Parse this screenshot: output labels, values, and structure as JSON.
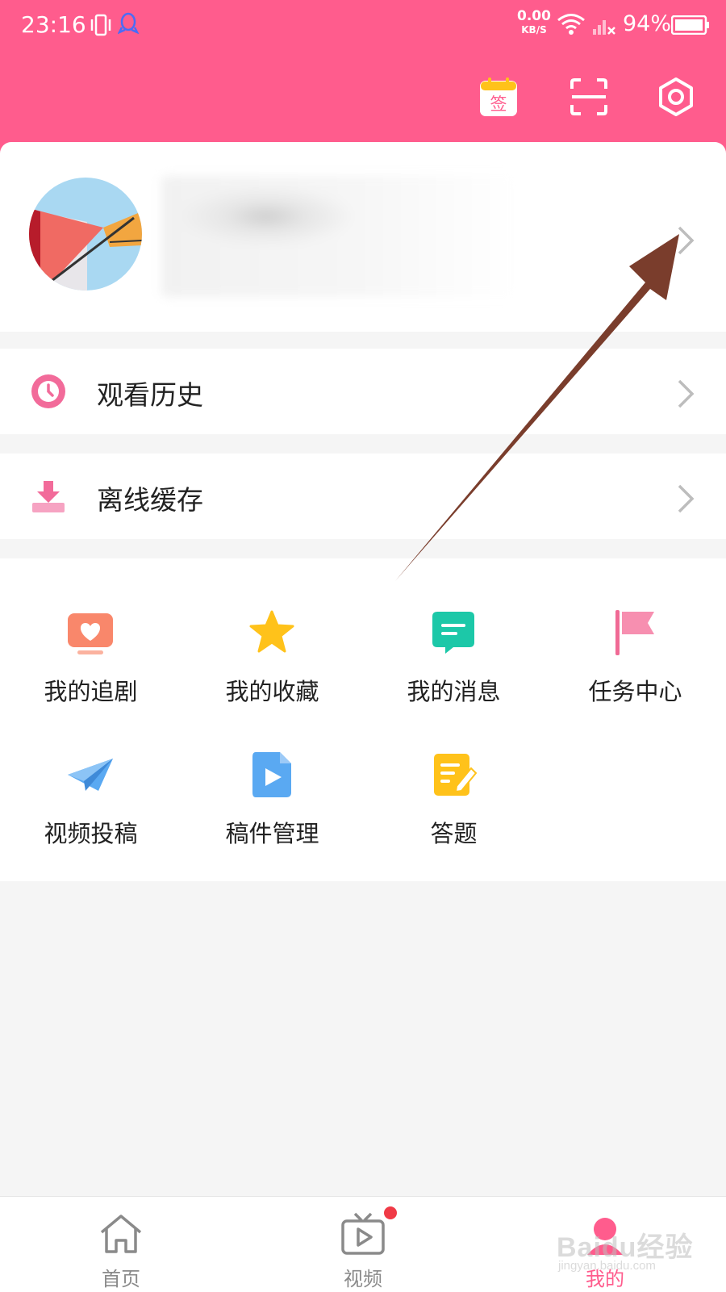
{
  "status_bar": {
    "time": "23:16",
    "net_speed_value": "0.00",
    "net_speed_unit": "KB/S",
    "battery": "94%",
    "icons": [
      "vibrate-icon",
      "qq-icon",
      "wifi-icon",
      "signal-icon",
      "battery-icon"
    ]
  },
  "header": {
    "sign_in_label": "签",
    "actions": [
      "calendar-sign-in-icon",
      "scan-icon",
      "settings-icon"
    ]
  },
  "menu": [
    {
      "label": "观看历史",
      "icon": "clock-icon"
    },
    {
      "label": "离线缓存",
      "icon": "download-icon"
    }
  ],
  "grid": [
    {
      "label": "我的追剧",
      "icon": "tv-heart-icon"
    },
    {
      "label": "我的收藏",
      "icon": "star-icon"
    },
    {
      "label": "我的消息",
      "icon": "message-icon"
    },
    {
      "label": "任务中心",
      "icon": "flag-icon"
    },
    {
      "label": "视频投稿",
      "icon": "paper-plane-icon"
    },
    {
      "label": "稿件管理",
      "icon": "video-file-icon"
    },
    {
      "label": "答题",
      "icon": "edit-note-icon"
    }
  ],
  "tabs": [
    {
      "label": "首页",
      "icon": "home-icon",
      "active": false
    },
    {
      "label": "视频",
      "icon": "tv-play-icon",
      "active": false,
      "badge": true
    },
    {
      "label": "我的",
      "icon": "profile-icon",
      "active": true
    }
  ],
  "colors": {
    "brand_pink": "#ff5c8d",
    "star_yellow": "#ffc21a",
    "message_teal": "#1cc8a8",
    "flag_pink": "#f06a95",
    "plane_blue": "#5aa9f2",
    "file_blue": "#5aa9f2",
    "note_yellow": "#ffc21a",
    "annotation_arrow": "#7a3d2c"
  },
  "watermark": {
    "main": "Baidu经验",
    "sub": "jingyan.baidu.com"
  }
}
